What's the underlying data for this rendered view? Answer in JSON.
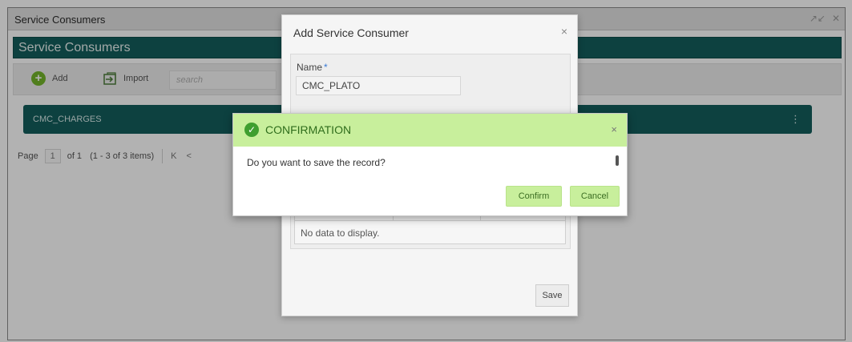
{
  "window": {
    "title": "Service Consumers",
    "controls": [
      "↗↙",
      "✕"
    ]
  },
  "header": {
    "title": "Service Consumers"
  },
  "toolbar": {
    "add_label": "Add",
    "import_label": "Import",
    "search_placeholder": "search"
  },
  "cards": [
    {
      "label": "CMC_CHARGES"
    }
  ],
  "pager": {
    "page_label": "Page",
    "page_value": "1",
    "of_label": "of 1",
    "range": "(1 - 3 of 3 items)",
    "first": "K",
    "prev": "<"
  },
  "modal": {
    "title": "Add Service Consumer",
    "name_label": "Name",
    "required_mark": "*",
    "name_value": "CMC_PLATO",
    "empty_text": "No data to display.",
    "save_label": "Save"
  },
  "confirm": {
    "title": "CONFIRMATION",
    "message": "Do you want to save the record?",
    "confirm_label": "Confirm",
    "cancel_label": "Cancel"
  },
  "colors": {
    "brand_teal": "#145e5c",
    "confirm_green": "#c8ef9c",
    "check_green": "#3f9f2f"
  }
}
